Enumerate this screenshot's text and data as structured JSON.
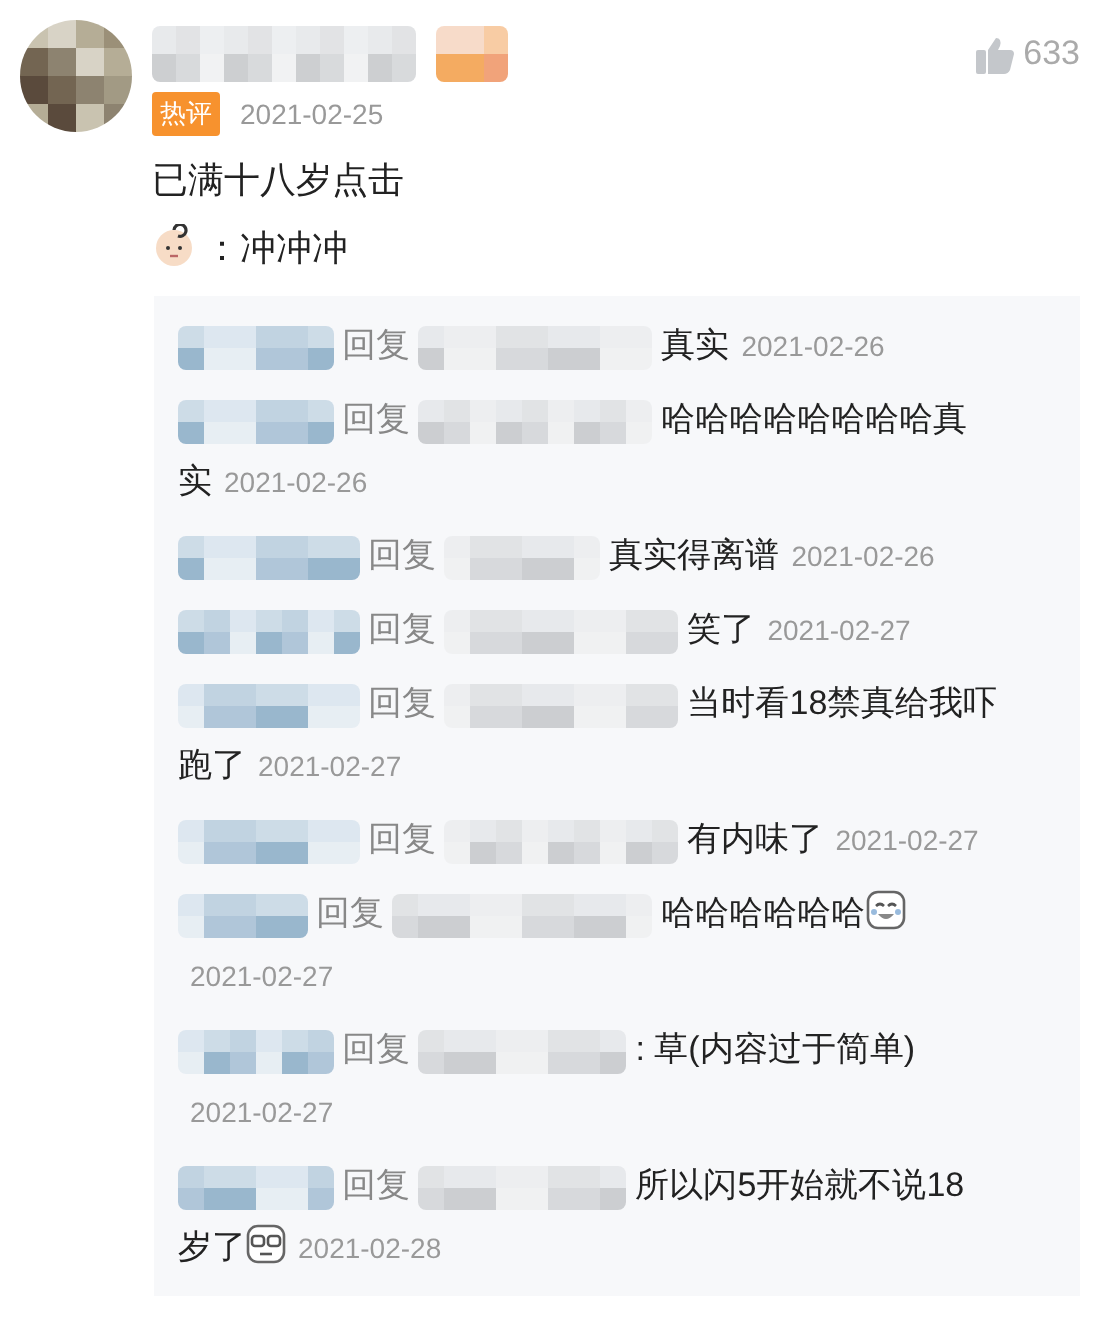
{
  "comment": {
    "tag": "热评",
    "date": "2021-02-25",
    "likes": "633",
    "lines": [
      {
        "kind": "plain",
        "text": "已满十八岁点击"
      },
      {
        "kind": "baby",
        "text": "：冲冲冲"
      }
    ]
  },
  "replies": [
    {
      "kind": "plain",
      "reply_word": "回复",
      "text_lines": [
        "真实"
      ],
      "date": "2021-02-26"
    },
    {
      "kind": "plain",
      "reply_word": "回复",
      "text_lines": [
        "哈哈哈哈哈哈哈哈真",
        "实"
      ],
      "date": "2021-02-26"
    },
    {
      "kind": "plain",
      "reply_word": "回复",
      "text_lines": [
        "真实得离谱"
      ],
      "date": "2021-02-26"
    },
    {
      "kind": "plain",
      "reply_word": "回复",
      "text_lines": [
        "笑了"
      ],
      "date": "2021-02-27"
    },
    {
      "kind": "plain",
      "reply_word": "回复",
      "text_lines": [
        "当时看18禁真给我吓",
        "跑了"
      ],
      "date": "2021-02-27"
    },
    {
      "kind": "plain",
      "reply_word": "回复",
      "text_lines": [
        "有内味了"
      ],
      "date": "2021-02-27"
    },
    {
      "kind": "laugh",
      "reply_word": "回复",
      "text_lines": [
        "哈哈哈哈哈哈"
      ],
      "date": "2021-02-27"
    },
    {
      "kind": "plain",
      "reply_word": "回复",
      "text_lines": [
        ": 草(内容过于简单)"
      ],
      "date": "2021-02-27"
    },
    {
      "kind": "glasses",
      "reply_word": "回复",
      "text_lines": [
        "所以闪5开始就不说18",
        "岁了"
      ],
      "date": "2021-02-28"
    }
  ]
}
